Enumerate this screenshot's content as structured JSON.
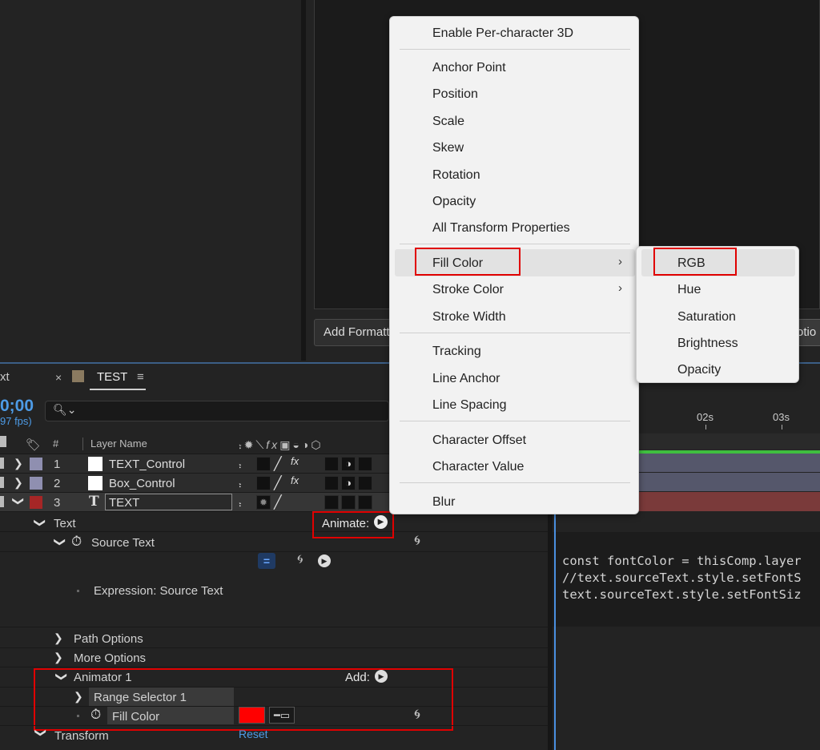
{
  "viewer": {
    "add_format_label": "Add Formatt",
    "right_button_label": "otio"
  },
  "timeline": {
    "tab_partial_label": "xt",
    "tab_close": "×",
    "tab_title": "TEST",
    "tab_menu": "≡",
    "timecode": "0;00",
    "fps": "97 fps)",
    "search_icon": "search-icon",
    "columns": {
      "number": "#",
      "layer_name": "Layer Name"
    },
    "layers": [
      {
        "num": "1",
        "name": "TEXT_Control",
        "color": "#8f8fb0"
      },
      {
        "num": "2",
        "name": "Box_Control",
        "color": "#8f8fb0"
      },
      {
        "num": "3",
        "name": "TEXT",
        "color": "#a62626"
      }
    ],
    "text_type_glyph": "T",
    "properties": {
      "text": "Text",
      "animate_label": "Animate:",
      "source_text": "Source Text",
      "expression_label": "Expression: Source Text",
      "path_options": "Path Options",
      "more_options": "More Options",
      "animator": "Animator 1",
      "add_label": "Add:",
      "range_selector": "Range Selector 1",
      "fill_color": "Fill Color",
      "fill_swatch_color": "#ff0000",
      "transform": "Transform",
      "reset": "Reset"
    },
    "ruler": {
      "ticks": [
        "02s",
        "03s"
      ]
    },
    "code_lines": [
      "const fontColor = thisComp.layer",
      "//text.sourceText.style.setFontS",
      "text.sourceText.style.setFontSiz"
    ]
  },
  "context_menu": {
    "items": [
      {
        "label": "Enable Per-character 3D"
      },
      {
        "label": "Anchor Point"
      },
      {
        "label": "Position"
      },
      {
        "label": "Scale"
      },
      {
        "label": "Skew"
      },
      {
        "label": "Rotation"
      },
      {
        "label": "Opacity"
      },
      {
        "label": "All Transform Properties"
      },
      {
        "label": "Fill Color",
        "submenu": true,
        "highlighted": true
      },
      {
        "label": "Stroke Color",
        "submenu": true
      },
      {
        "label": "Stroke Width"
      },
      {
        "label": "Tracking"
      },
      {
        "label": "Line Anchor"
      },
      {
        "label": "Line Spacing"
      },
      {
        "label": "Character Offset"
      },
      {
        "label": "Character Value"
      },
      {
        "label": "Blur"
      }
    ]
  },
  "submenu": {
    "items": [
      "RGB",
      "Hue",
      "Saturation",
      "Brightness",
      "Opacity"
    ]
  },
  "colors": {
    "accent_blue": "#4d9be6",
    "annotation_red": "#e00000",
    "menu_bg": "#f2f2f2"
  }
}
